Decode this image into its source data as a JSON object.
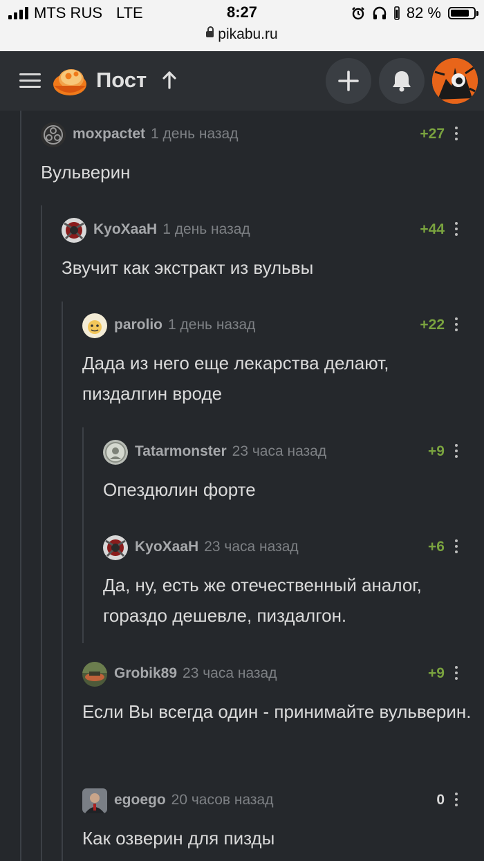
{
  "status_bar": {
    "carrier": "MTS RUS",
    "network": "LTE",
    "time": "8:27",
    "battery_text": "82 %",
    "battery_level": 0.82,
    "url": "pikabu.ru"
  },
  "header": {
    "title": "Пост",
    "icons": [
      "menu-icon",
      "pikabu-logo",
      "up-arrow-icon",
      "plus-icon",
      "bell-icon",
      "user-avatar"
    ]
  },
  "comments": [
    {
      "username": "moxpactet",
      "time": "1 день назад",
      "rating": "+27",
      "text": "Вульверин",
      "level": 0
    },
    {
      "username": "KyoXaaH",
      "time": "1 день назад",
      "rating": "+44",
      "text": "Звучит как экстракт из вульвы",
      "level": 1
    },
    {
      "username": "parolio",
      "time": "1 день назад",
      "rating": "+22",
      "text": "Дада из него еще лекарства делают, пиздалгин вроде",
      "level": 2
    },
    {
      "username": "Tatarmonster",
      "time": "23 часа назад",
      "rating": "+9",
      "text": "Опездюлин форте",
      "level": 3
    },
    {
      "username": "KyoXaaH",
      "time": "23 часа назад",
      "rating": "+6",
      "text": "Да, ну,  есть же отечественный аналог, гораздо дешевле, пиздалгон.",
      "level": 3
    },
    {
      "username": "Grobik89",
      "time": "23 часа назад",
      "rating": "+9",
      "text": "Если Вы всегда один - принимайте вульверин.",
      "level": 2
    },
    {
      "username": "egoego",
      "time": "20 часов назад",
      "rating": "0",
      "text": "Как озверин для пизды",
      "level": 2
    }
  ]
}
